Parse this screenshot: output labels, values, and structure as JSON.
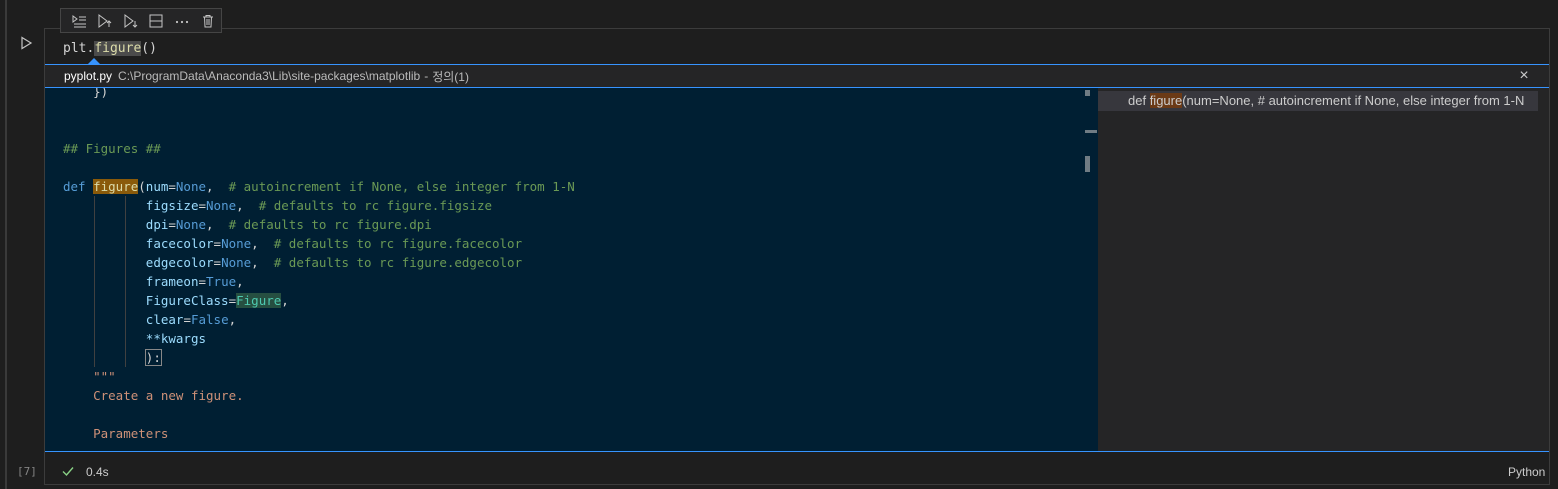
{
  "toolbar": {
    "buttons": [
      "run-by-line",
      "execute-above",
      "execute-below",
      "split-cell",
      "more-actions",
      "delete-cell"
    ]
  },
  "cell": {
    "source_prefix": "plt.",
    "source_symbol": "figure",
    "source_suffix": "()",
    "execution_count": "[7]",
    "status_time": "0.4s",
    "language": "Python"
  },
  "peek": {
    "file_name": "pyplot.py",
    "file_path": "C:\\ProgramData\\Anaconda3\\Lib\\site-packages\\matplotlib",
    "separator": "-",
    "definition_label": "정의(1)",
    "close_label": "×",
    "reference": {
      "prefix": "def ",
      "symbol": "figure",
      "suffix": "(num=None, # autoincrement if None, else integer from 1-N"
    },
    "code": {
      "line_0": "    })",
      "line_section": "## Figures ##",
      "def_kw": "def",
      "def_name": "figure",
      "def_open": "(",
      "p1": "num",
      "p1v": "None",
      "p1c": "  # autoincrement if None, else integer from 1-N",
      "p2": "figsize",
      "p2v": "None",
      "p2c": "  # defaults to rc figure.figsize",
      "p3": "dpi",
      "p3v": "None",
      "p3c": "  # defaults to rc figure.dpi",
      "p4": "facecolor",
      "p4v": "None",
      "p4c": "  # defaults to rc figure.facecolor",
      "p5": "edgecolor",
      "p5v": "None",
      "p5c": "  # defaults to rc figure.edgecolor",
      "p6": "frameon",
      "p6v": "True",
      "p7": "FigureClass",
      "p7v": "Figure",
      "p8": "clear",
      "p8v": "False",
      "p9": "**kwargs",
      "close": "):",
      "docstring_open": "\"\"\"",
      "doc1": "Create a new figure.",
      "doc2": "Parameters"
    }
  },
  "colors": {
    "accent": "#3794ff",
    "peek_bg": "#001f33",
    "match_highlight": "#8a5a0a"
  }
}
